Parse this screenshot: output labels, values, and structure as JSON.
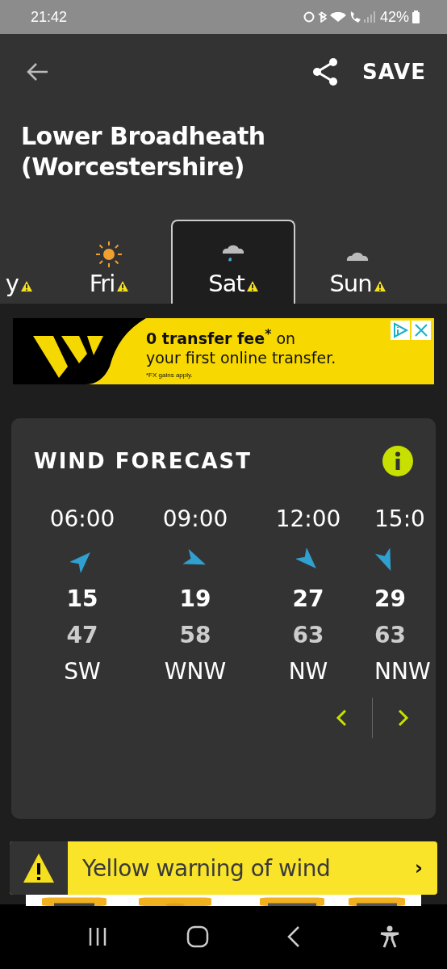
{
  "status_bar": {
    "time": "21:42",
    "battery": "42%"
  },
  "header": {
    "save": "SAVE",
    "title": "Lower Broadheath (Worcestershire)"
  },
  "day_tabs": [
    {
      "label": "y",
      "warning": true,
      "selected": false
    },
    {
      "label": "Fri",
      "kind": "sun",
      "warning": true,
      "selected": false
    },
    {
      "label": "Sat",
      "kind": "rain",
      "warning": true,
      "selected": true
    },
    {
      "label": "Sun",
      "kind": "cloud",
      "warning": true,
      "selected": false
    }
  ],
  "ad": {
    "headline": "**0 transfer fee$^{*}$** on",
    "line2": "your first online transfer.",
    "footnote": "*FX gains apply."
  },
  "wind_forecast": {
    "title": "WIND FORECAST",
    "columns": [
      {
        "time": "06:00",
        "kind": "ne",
        "speed": "15",
        "gust": "47",
        "direction": "SW"
      },
      {
        "time": "09:00",
        "kind": "ese",
        "speed": "19",
        "gust": "58",
        "direction": "WNW"
      },
      {
        "time": "12:00",
        "kind": "se",
        "speed": "27",
        "gust": "63",
        "direction": "NW"
      },
      {
        "time": "15:0",
        "kind": "sse",
        "speed": "29",
        "gust": "63",
        "direction": "NNW"
      }
    ]
  },
  "warning_banner": {
    "text": "Yellow warning of wind",
    "chevron": "›"
  }
}
